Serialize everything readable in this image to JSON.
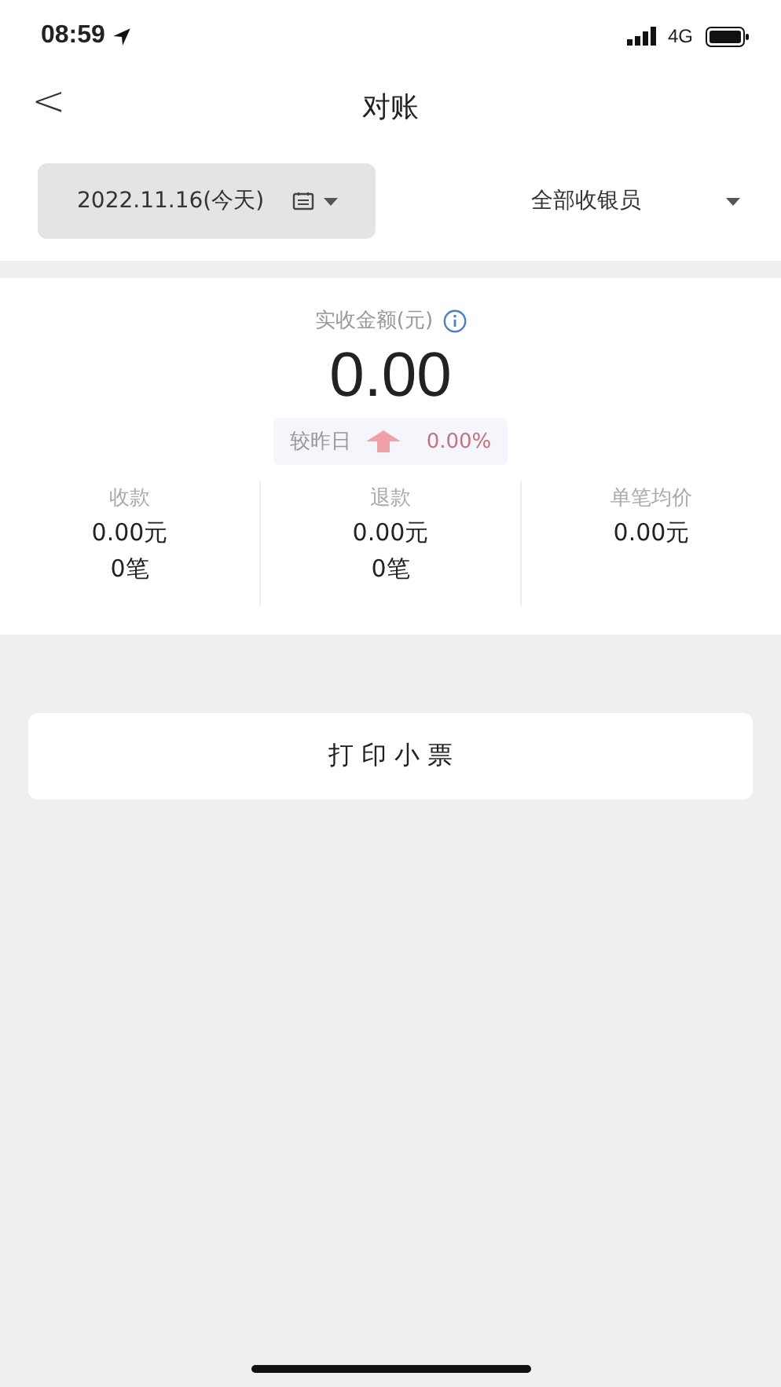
{
  "status_bar": {
    "time": "08:59",
    "network": "4G"
  },
  "nav": {
    "back": "<",
    "title": "对账"
  },
  "filters": {
    "date": "2022.11.16(今天)",
    "cashier": "全部收银员"
  },
  "summary": {
    "label": "实收金额(元)",
    "amount": "0.00",
    "compare_label": "较昨日",
    "compare_value": "0.00%"
  },
  "stats": [
    {
      "label": "收款",
      "amount": "0.00元",
      "count": "0笔"
    },
    {
      "label": "退款",
      "amount": "0.00元",
      "count": "0笔"
    },
    {
      "label": "单笔均价",
      "amount": "0.00元"
    }
  ],
  "print_button": "打 印 小 票"
}
